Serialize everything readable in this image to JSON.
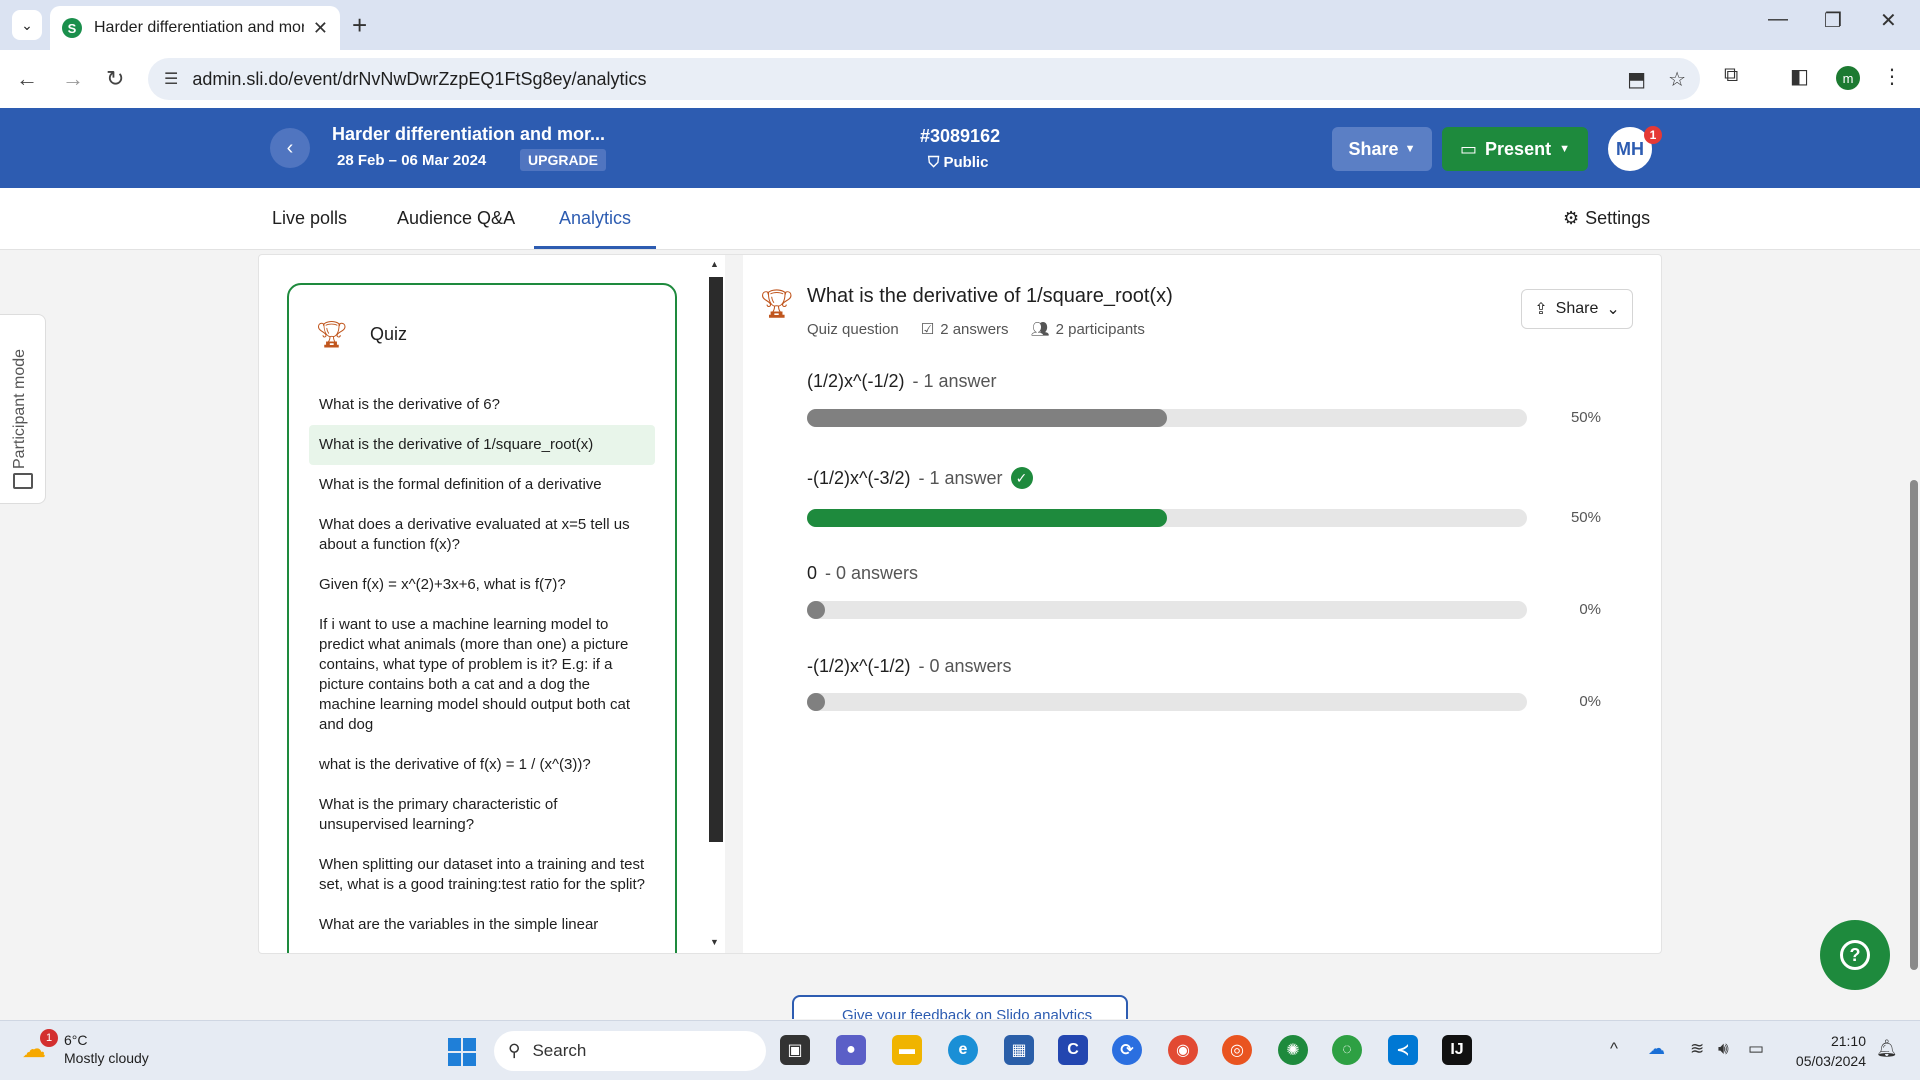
{
  "browser": {
    "tab_title": "Harder differentiation and more",
    "favicon_letter": "S",
    "url": "admin.sli.do/event/drNvNwDwrZzpEQ1FtSg8ey/analytics",
    "profile_initial": "m"
  },
  "header": {
    "event_title": "Harder differentiation and mor...",
    "event_dates": "28 Feb – 06 Mar 2024",
    "upgrade_label": "UPGRADE",
    "event_code": "#3089162",
    "visibility": "Public",
    "share_label": "Share",
    "present_label": "Present",
    "avatar_initials": "MH",
    "avatar_badge": "1"
  },
  "tabs": [
    {
      "label": "Live polls"
    },
    {
      "label": "Audience Q&A"
    },
    {
      "label": "Analytics"
    }
  ],
  "settings_label": "Settings",
  "participant_mode_label": "Participant mode",
  "quiz": {
    "title": "Quiz",
    "questions": [
      "What is the derivative of 6?",
      "What is the derivative of 1/square_root(x)",
      "What is the formal definition of a derivative",
      "What does a derivative evaluated at x=5 tell us about a function f(x)?",
      "Given f(x) = x^(2)+3x+6, what is f(7)?",
      "If i want to use a machine learning model to predict what animals (more than one) a picture contains, what type of problem is it? E.g: if a picture contains both a cat and a dog the machine learning model should output both cat and dog",
      "what is the derivative of f(x) = 1 / (x^(3))?",
      "What is the primary characteristic of unsupervised learning?",
      "When splitting our dataset into a training and test set, what is a good training:test ratio for the split?",
      "What are the variables in the simple linear"
    ]
  },
  "detail": {
    "title": "What is the derivative of 1/square_root(x)",
    "type_label": "Quiz question",
    "answers_label": "2 answers",
    "participants_label": "2 participants",
    "share_label": "Share",
    "options": [
      {
        "text": "(1/2)x^(-1/2)",
        "count": "- 1 answer",
        "percent": "50%",
        "fraction": 0.5,
        "correct": false
      },
      {
        "text": "-(1/2)x^(-3/2)",
        "count": "- 1 answer",
        "percent": "50%",
        "fraction": 0.5,
        "correct": true
      },
      {
        "text": "0",
        "count": "- 0 answers",
        "percent": "0%",
        "fraction": 0,
        "correct": false
      },
      {
        "text": "-(1/2)x^(-1/2)",
        "count": "- 0 answers",
        "percent": "0%",
        "fraction": 0,
        "correct": false
      }
    ],
    "colors": {
      "default_fill": "#808080",
      "correct_fill": "#1e8a3d"
    }
  },
  "feedback_label": "Give your feedback on Slido analytics",
  "help_label": "?",
  "taskbar": {
    "weather_temp": "6°C",
    "weather_desc": "Mostly cloudy",
    "weather_badge": "1",
    "search_label": "Search",
    "time": "21:10",
    "date": "05/03/2024"
  }
}
